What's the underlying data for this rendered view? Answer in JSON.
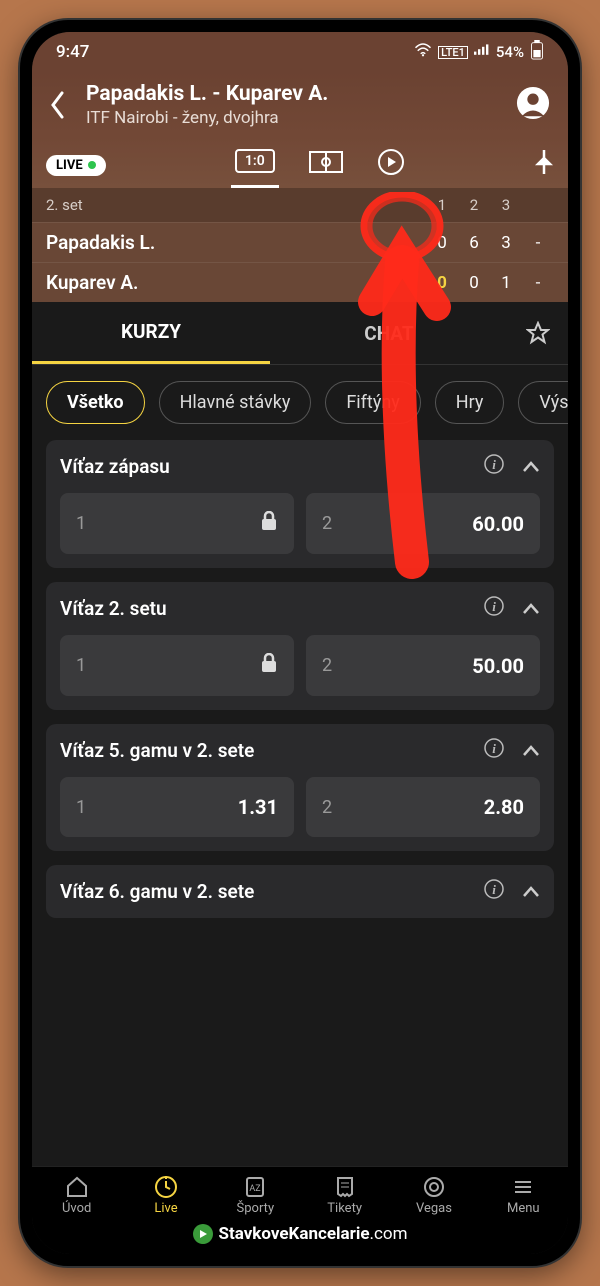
{
  "statusbar": {
    "time": "9:47",
    "net": "LTE1",
    "signal": "📶",
    "battery": "54%"
  },
  "header": {
    "title": "Papadakis L. - Kuparev A.",
    "subtitle": "ITF Nairobi - ženy, dvojhra"
  },
  "live_badge": "LIVE",
  "score_tab": "1:0",
  "scoreboard": {
    "set_label": "2. set",
    "cols": [
      "",
      "1",
      "2",
      "3"
    ],
    "rows": [
      {
        "name": "Papadakis L.",
        "pt": "0",
        "s1": "6",
        "s2": "3",
        "s3": "-"
      },
      {
        "name": "Kuparev A.",
        "pt": "0",
        "s1": "0",
        "s2": "1",
        "s3": "-"
      }
    ]
  },
  "main_tabs": {
    "odds": "KURZY",
    "chat": "CHAT"
  },
  "filters": [
    "Všetko",
    "Hlavné stávky",
    "Fiftýny",
    "Hry",
    "Výs"
  ],
  "markets": [
    {
      "title": "Víťaz zápasu",
      "odds": [
        {
          "label": "1",
          "value": "",
          "locked": true
        },
        {
          "label": "2",
          "value": "60.00",
          "locked": false
        }
      ]
    },
    {
      "title": "Víťaz 2. setu",
      "odds": [
        {
          "label": "1",
          "value": "",
          "locked": true
        },
        {
          "label": "2",
          "value": "50.00",
          "locked": false
        }
      ]
    },
    {
      "title": "Víťaz 5. gamu v 2. sete",
      "odds": [
        {
          "label": "1",
          "value": "1.31",
          "locked": false
        },
        {
          "label": "2",
          "value": "2.80",
          "locked": false
        }
      ]
    },
    {
      "title": "Víťaz 6. gamu v 2. sete",
      "odds": []
    }
  ],
  "bottomnav": [
    {
      "label": "Úvod"
    },
    {
      "label": "Live"
    },
    {
      "label": "Športy"
    },
    {
      "label": "Tikety"
    },
    {
      "label": "Vegas"
    },
    {
      "label": "Menu"
    }
  ],
  "brand": {
    "text1": "StavkoveKancelarie",
    "text2": ".com"
  }
}
